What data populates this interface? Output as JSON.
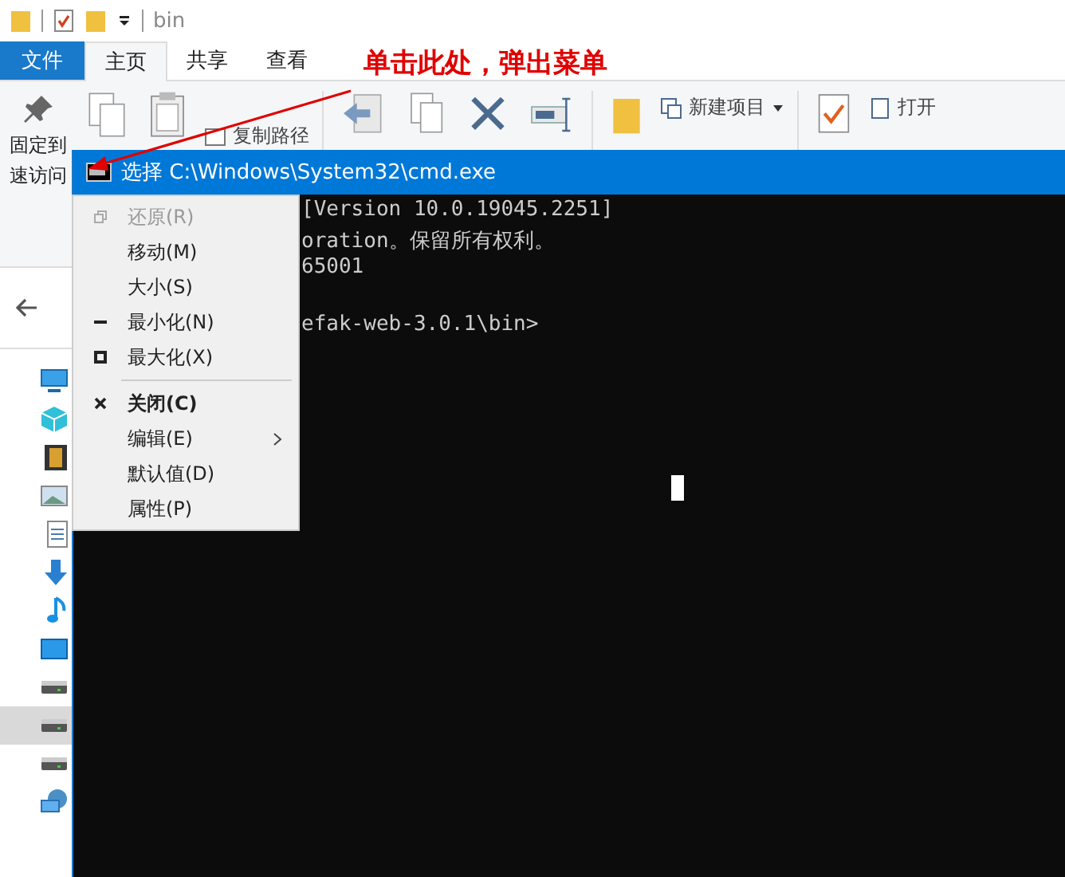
{
  "explorer": {
    "title": "bin",
    "tabs": [
      {
        "label": "文件",
        "kind": "file",
        "selected": false
      },
      {
        "label": "主页",
        "kind": "tab",
        "selected": true
      },
      {
        "label": "共享",
        "kind": "tab",
        "selected": false
      },
      {
        "label": "查看",
        "kind": "tab",
        "selected": false
      }
    ],
    "ribbon": {
      "pin_label_1": "固定到",
      "pin_label_2": "速访问",
      "copy_path": "复制路径",
      "new_item": "新建项目",
      "open": "打开"
    },
    "sidebar": {
      "items": [
        {
          "kind": "computer",
          "selected": false
        },
        {
          "kind": "cube",
          "selected": false
        },
        {
          "kind": "film",
          "selected": false
        },
        {
          "kind": "image",
          "selected": false
        },
        {
          "kind": "document",
          "selected": false
        },
        {
          "kind": "download",
          "selected": false
        },
        {
          "kind": "music",
          "selected": false
        },
        {
          "kind": "desktop",
          "selected": false
        },
        {
          "kind": "drive",
          "selected": false
        },
        {
          "kind": "drive",
          "selected": true
        },
        {
          "kind": "drive",
          "selected": false
        },
        {
          "kind": "network",
          "selected": false
        }
      ]
    }
  },
  "cmd": {
    "title": "选择 C:\\Windows\\System32\\cmd.exe",
    "paragraphs": [
      [
        "[Version 10.0.19045.2251]",
        "oration。保留所有权利。",
        "65001"
      ],
      [
        "efak-web-3.0.1\\bin>"
      ]
    ]
  },
  "menu": {
    "items": [
      {
        "label": "还原(R)",
        "kind": "restore",
        "disabled": true,
        "bold": false,
        "submenu": false
      },
      {
        "label": "移动(M)",
        "kind": "plain",
        "disabled": false,
        "bold": false,
        "submenu": false
      },
      {
        "label": "大小(S)",
        "kind": "plain",
        "disabled": false,
        "bold": false,
        "submenu": false
      },
      {
        "label": "最小化(N)",
        "kind": "minimize",
        "disabled": false,
        "bold": false,
        "submenu": false
      },
      {
        "label": "最大化(X)",
        "kind": "maximize",
        "disabled": false,
        "bold": false,
        "submenu": false
      },
      {
        "kind": "separator"
      },
      {
        "label": "关闭(C)",
        "kind": "close",
        "disabled": false,
        "bold": true,
        "submenu": false
      },
      {
        "label": "编辑(E)",
        "kind": "plain",
        "disabled": false,
        "bold": false,
        "submenu": true
      },
      {
        "label": "默认值(D)",
        "kind": "plain",
        "disabled": false,
        "bold": false,
        "submenu": false
      },
      {
        "label": "属性(P)",
        "kind": "plain",
        "disabled": false,
        "bold": false,
        "submenu": false
      }
    ]
  },
  "annotation": {
    "text": "单击此处，弹出菜单"
  }
}
